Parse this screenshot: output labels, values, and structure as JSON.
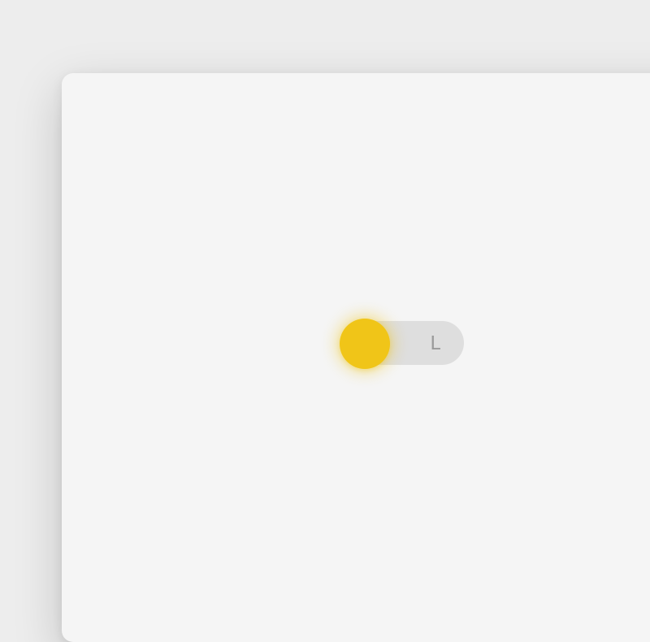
{
  "toggle": {
    "right_label": "L",
    "state": "off",
    "knob_color": "#f0c518",
    "track_color": "#dedede",
    "label_color": "#9a9a9a"
  },
  "card": {
    "background": "#f5f5f5"
  },
  "page": {
    "background": "#ededed"
  }
}
